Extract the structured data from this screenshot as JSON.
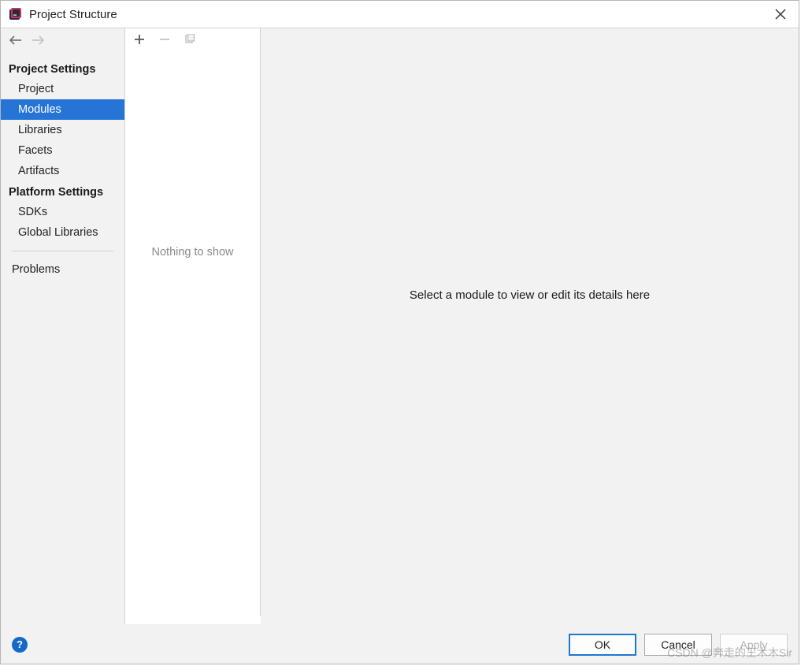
{
  "window": {
    "title": "Project Structure"
  },
  "nav": {
    "back_enabled": true,
    "forward_enabled": false
  },
  "sidebar": {
    "sections": [
      {
        "header": "Project Settings",
        "items": [
          {
            "key": "project",
            "label": "Project",
            "selected": false
          },
          {
            "key": "modules",
            "label": "Modules",
            "selected": true
          },
          {
            "key": "libraries",
            "label": "Libraries",
            "selected": false
          },
          {
            "key": "facets",
            "label": "Facets",
            "selected": false
          },
          {
            "key": "artifacts",
            "label": "Artifacts",
            "selected": false
          }
        ]
      },
      {
        "header": "Platform Settings",
        "items": [
          {
            "key": "sdks",
            "label": "SDKs",
            "selected": false
          },
          {
            "key": "global-libraries",
            "label": "Global Libraries",
            "selected": false
          }
        ]
      }
    ],
    "extra": [
      {
        "key": "problems",
        "label": "Problems",
        "selected": false
      }
    ]
  },
  "modules": {
    "empty_text": "Nothing to show",
    "toolbar": {
      "add_enabled": true,
      "remove_enabled": false,
      "copy_enabled": false
    }
  },
  "detail": {
    "placeholder": "Select a module to view or edit its details here"
  },
  "footer": {
    "ok": "OK",
    "cancel": "Cancel",
    "apply": "Apply",
    "apply_enabled": false
  },
  "watermark": "CSDN @奔走的王木木Sir"
}
